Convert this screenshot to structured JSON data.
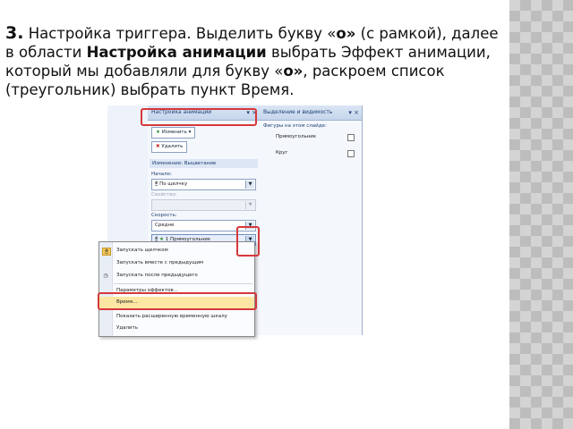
{
  "slide": {
    "step_number": "3.",
    "text_part1": " Настройка триггера. Выделить букву «",
    "letter1": "о»",
    "text_part2": " (с рамкой), далее в области ",
    "bold_area": "Настройка анимации",
    "text_part3": " выбрать Эффект анимации, который мы добавляли для букву «",
    "letter2": "о»",
    "text_part4": ", раскроем список (треугольник) выбрать пункт Время."
  },
  "screenshot": {
    "pane1_title": "Настройка анимации",
    "pane2_title": "Выделение и видимость",
    "change_button": "Изменить",
    "delete_button": "Удалить",
    "modify_header": "Изменение: Выцветание",
    "start_label": "Начало:",
    "start_value": "По щелчку",
    "property_label": "Свойство:",
    "speed_label": "Скорость:",
    "speed_value": "Средне",
    "effect_item": "1  Прямоугольник",
    "shapes_header": "Фигуры на этом слайде:",
    "shapes": [
      "Прямоугольник",
      "Круг"
    ],
    "menu_items": [
      "Запускать щелчком",
      "Запускать вместе с предыдущим",
      "Запускать после предыдущего",
      "Параметры эффектов...",
      "Время...",
      "Показать расширенную временную шкалу",
      "Удалить"
    ]
  }
}
